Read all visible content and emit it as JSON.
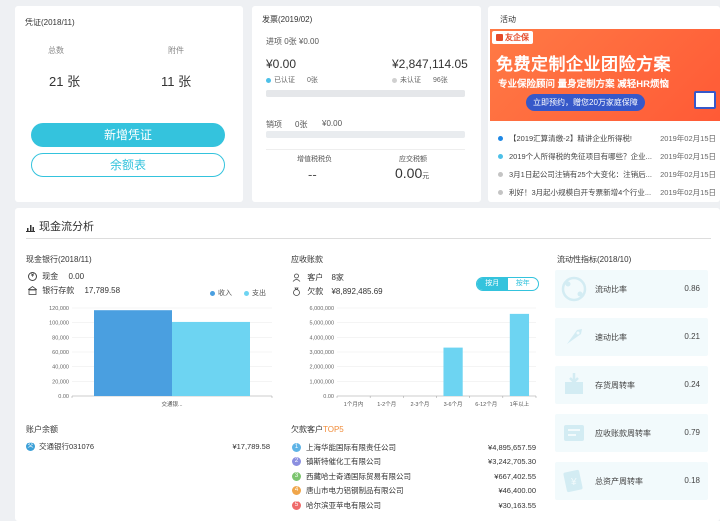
{
  "voucher": {
    "title": "凭证(2018/11)",
    "total_label": "总数",
    "attach_label": "附件",
    "total_value": "21 张",
    "attach_value": "11 张",
    "new_button": "新增凭证",
    "balance_button": "余额表"
  },
  "invoice": {
    "title": "发票(2019/02)",
    "in_label": "进项 0张 ¥0.00",
    "amount_left": "¥0.00",
    "amount_right": "¥2,847,114.05",
    "verified": "已认证",
    "verified_count": "0张",
    "unverified": "未认证",
    "unverified_count": "96张",
    "out_label": "销项",
    "out_count": "0张",
    "out_amount": "¥0.00",
    "vat_label": "增值税税负",
    "vat_value": "--",
    "tax_label": "应交税额",
    "tax_value": "0.00",
    "tax_unit": "元",
    "progress_verified": 0.0,
    "progress_unverified": 1.0
  },
  "activity": {
    "title": "活动",
    "banner_logo": "友企保",
    "banner_headline": "免费定制企业团险方案",
    "banner_sub": "专业保险顾问  量身定制方案  减轻HR烦恼",
    "banner_cta": "立即预约，赠您20万家庭保障",
    "news": [
      {
        "title": "【2019汇算清缴-2】精讲企业所得税!",
        "date": "2019年02月15日",
        "color": "#1e88e5"
      },
      {
        "title": "2019个人所得税的免征项目有哪些？企业...",
        "date": "2019年02月15日",
        "color": "#4dc0e8"
      },
      {
        "title": "3月1日起公司注销有25个大变化：注销后...",
        "date": "2019年02月15日",
        "color": "#c4c4c4"
      },
      {
        "title": "利好！3月起小规模自开专票新增4个行业...",
        "date": "2019年02月15日",
        "color": "#c4c4c4"
      }
    ]
  },
  "cash_flow": {
    "title": "现金流分析",
    "bank": {
      "title": "现金银行(2018/11)",
      "cash_label": "现金",
      "cash_value": "0.00",
      "deposit_label": "银行存款",
      "deposit_value": "17,789.58",
      "legend_in": "收入",
      "legend_out": "支出",
      "legend_in_color": "#4a9fe0",
      "legend_out_color": "#6dd4f2"
    },
    "receivable": {
      "title": "应收账款",
      "customers_label": "客户",
      "customers_value": "8家",
      "debt_label": "欠款",
      "debt_value": "¥8,892,485.69",
      "toggle_month": "按月",
      "toggle_year": "按年"
    },
    "liquidity": {
      "title": "流动性指标(2018/10)",
      "items": [
        {
          "label": "流动比率",
          "value": "0.86",
          "icon": "flow-ratio-icon"
        },
        {
          "label": "速动比率",
          "value": "0.21",
          "icon": "rocket-icon"
        },
        {
          "label": "存货周转率",
          "value": "0.24",
          "icon": "inventory-icon"
        },
        {
          "label": "应收账款周转率",
          "value": "0.79",
          "icon": "receivable-icon"
        },
        {
          "label": "总资产周转率",
          "value": "0.18",
          "icon": "assets-icon"
        }
      ]
    },
    "accounts": {
      "title": "账户余额",
      "items": [
        {
          "name": "交通银行031076",
          "value": "¥17,789.58"
        }
      ]
    },
    "debtors": {
      "title_prefix": "欠款客户",
      "title_suffix": "TOP5",
      "items": [
        {
          "rank": "1",
          "name": "上海华能国际有限责任公司",
          "value": "¥4,895,657.59",
          "color": "#5fb4e6"
        },
        {
          "rank": "2",
          "name": "镇斯特催化工有限公司",
          "value": "¥3,242,705.30",
          "color": "#8b8fe0"
        },
        {
          "rank": "3",
          "name": "西藏哈士奇通国际贸易有限公司",
          "value": "¥667,402.55",
          "color": "#7cc56f"
        },
        {
          "rank": "4",
          "name": "唐山市电力铝钢制品有限公司",
          "value": "¥46,400.00",
          "color": "#f0a64a"
        },
        {
          "rank": "5",
          "name": "哈尔滨亚苹电有限公司",
          "value": "¥30,163.55",
          "color": "#ef6a6a"
        }
      ]
    }
  },
  "chart_data": [
    {
      "type": "bar",
      "categories": [
        "交通银..."
      ],
      "series": [
        {
          "name": "收入",
          "values": [
            117000
          ]
        },
        {
          "name": "支出",
          "values": [
            101000
          ]
        }
      ],
      "ylim": [
        0,
        120000
      ],
      "yticks": [
        "0.00",
        "20,000",
        "40,000",
        "60,000",
        "80,000",
        "100,000",
        "120,000"
      ]
    },
    {
      "type": "bar",
      "categories": [
        "1个月内",
        "1-2个月",
        "2-3个月",
        "3-6个月",
        "6-12个月",
        "1年以上"
      ],
      "values": [
        0,
        0,
        0,
        3300000,
        0,
        5600000
      ],
      "ylim": [
        0,
        6000000
      ],
      "yticks": [
        "0.00",
        "1,000,000",
        "2,000,000",
        "3,000,000",
        "4,000,000",
        "5,000,000",
        "6,000,000"
      ]
    }
  ]
}
